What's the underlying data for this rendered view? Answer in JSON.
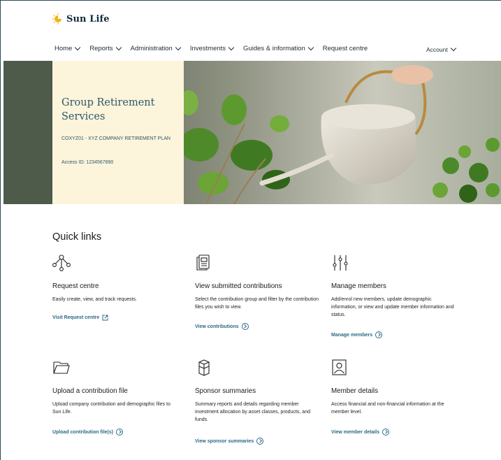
{
  "brand": {
    "name": "Sun Life",
    "accent": "#2a6b85",
    "hero_bg": "#fdf4dc"
  },
  "nav": {
    "items": [
      {
        "label": "Home",
        "dropdown": true
      },
      {
        "label": "Reports",
        "dropdown": true
      },
      {
        "label": "Administration",
        "dropdown": true
      },
      {
        "label": "Investments",
        "dropdown": true
      },
      {
        "label": "Guides & information",
        "dropdown": true
      },
      {
        "label": "Request centre",
        "dropdown": false
      }
    ],
    "account_label": "Account"
  },
  "hero": {
    "title": "Group Retirement Services",
    "plan": "COXYZ01 - XYZ COMPANY RETIREMENT PLAN",
    "access_id": "Access ID: 1234567890"
  },
  "quick_links": {
    "title": "Quick links",
    "cards": [
      {
        "icon": "request-icon",
        "title": "Request centre",
        "description": "Easily create, view, and track requests.",
        "link": "Visit Request centre",
        "link_icon": "external-link-icon"
      },
      {
        "icon": "contributions-icon",
        "title": "View submitted contributions",
        "description": "Select the contribution group and filter by the contribution files you wish to view.",
        "link": "View contributions",
        "link_icon": "chevron-circle-icon"
      },
      {
        "icon": "sliders-icon",
        "title": "Manage members",
        "description": "Add/enrol new members, update demographic information, or view and update member information and status.",
        "link": "Manage members",
        "link_icon": "chevron-circle-icon"
      },
      {
        "icon": "folder-icon",
        "title": "Upload a contribution file",
        "description": "Upload company contribution and demographic files to Sun Life.",
        "link": "Upload contribution file(s)",
        "link_icon": "chevron-circle-icon"
      },
      {
        "icon": "box-icon",
        "title": "Sponsor summaries",
        "description": "Summary reports and details regarding member investment allocation by asset classes, products, and funds.",
        "link": "View sponsor summaries",
        "link_icon": "chevron-circle-icon"
      },
      {
        "icon": "member-icon",
        "title": "Member details",
        "description": "Access financial and non-financial information at the member level.",
        "link": "View member details",
        "link_icon": "chevron-circle-icon"
      }
    ]
  }
}
